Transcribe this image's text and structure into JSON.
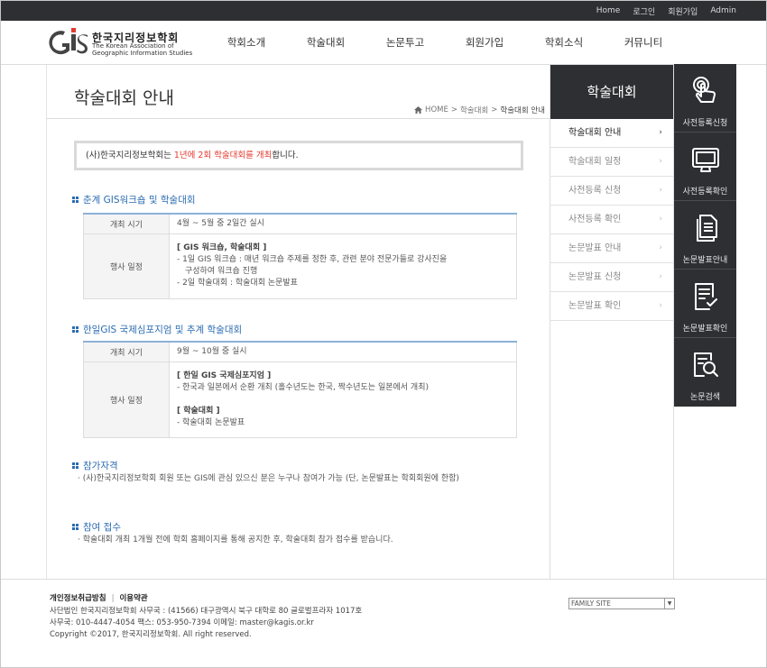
{
  "topbar": {
    "links": [
      "Home",
      "로그인",
      "회원가입",
      "Admin"
    ]
  },
  "logo": {
    "name_ko": "한국지리정보학회",
    "name_en_1": "The Korean Association of",
    "name_en_2": "Geographic Information Studies"
  },
  "gnb": [
    "학회소개",
    "학술대회",
    "논문투고",
    "회원가입",
    "학회소식",
    "커뮤니티"
  ],
  "page": {
    "title": "학술대회 안내",
    "breadcrumb": [
      "HOME",
      ">",
      "학술대회",
      ">",
      "학술대회 안내"
    ]
  },
  "notice": {
    "pre": "(사)한국지리정보학회는 ",
    "highlight": "1년에 2회 학술대회를 개최",
    "post": "합니다."
  },
  "sections": [
    {
      "title": "춘계 GIS워크숍 및 학술대회",
      "rows": [
        {
          "label": "개최 시기",
          "lines": [
            "4월 ~ 5월 중 2일간 실시"
          ]
        },
        {
          "label": "행사 일정",
          "heading": "[ GIS 워크숍, 학술대회 ]",
          "lines": [
            "- 1일 GIS 워크숍 : 매년 워크숍 주제를 정한 후, 관련 분야 전문가들로 강사진을",
            "   구성하여 워크숍 진행",
            "- 2일 학술대회 : 학술대회 논문발표"
          ]
        }
      ]
    },
    {
      "title": "한일GIS 국제심포지엄 및 추계 학술대회",
      "rows": [
        {
          "label": "개최 시기",
          "lines": [
            "9월 ~ 10월 중 실시"
          ]
        },
        {
          "label": "행사 일정",
          "heading": "[ 한일 GIS 국제심포지엄 ]",
          "lines": [
            "- 한국과 일본에서 순환 개최 (홀수년도는 한국, 짝수년도는 일본에서 개최)"
          ],
          "heading2": "[ 학술대회 ]",
          "lines2": [
            "- 학술대회 논문발표"
          ]
        }
      ]
    },
    {
      "title": "참가자격",
      "text": "· (사)한국지리정보학회 회원 또는 GIS에 관심 있으신 분은 누구나 참여가 가능 (단, 논문발표는 학회회원에 한함)"
    },
    {
      "title": "참여 접수",
      "text": "· 학술대회 개최 1개월 전에 학회 홈페이지를 통해 공지한 후, 학술대회 참가 접수를 받습니다."
    }
  ],
  "submenu": {
    "title": "학술대회",
    "items": [
      "학술대회 안내",
      "학술대회 일정",
      "사전등록 신청",
      "사전등록 확인",
      "논문발표 안내",
      "논문발표 신청",
      "논문발표 확인"
    ],
    "active": "학술대회 안내",
    "arrow": "›"
  },
  "quick": [
    {
      "label": "사전등록신청",
      "icon": "hand-touch-icon"
    },
    {
      "label": "사전등록확인",
      "icon": "monitor-icon"
    },
    {
      "label": "논문발표안내",
      "icon": "document-icon"
    },
    {
      "label": "논문발표확인",
      "icon": "checklist-icon"
    },
    {
      "label": "논문검색",
      "icon": "search-document-icon"
    }
  ],
  "footer": {
    "links": [
      "개인정보취급방침",
      "이용약관"
    ],
    "sep": "|",
    "line1": "사단법인 한국지리정보학회 사무국 : (41566) 대구광역시 북구 대학로 80 글로벌프라자 1017호",
    "line2": "사무국: 010-4447-4054 팩스: 053-950-7394 이메일: master@kagis.or.kr",
    "line3": "Copyright ©2017, 한국지리정보학회. All right reserved.",
    "family_site": "FAMILY SITE"
  },
  "colors": {
    "dark": "#2d2f33",
    "accent_blue": "#2b6cb2",
    "accent_red": "#e43a2e",
    "table_top": "#8db1d9"
  }
}
